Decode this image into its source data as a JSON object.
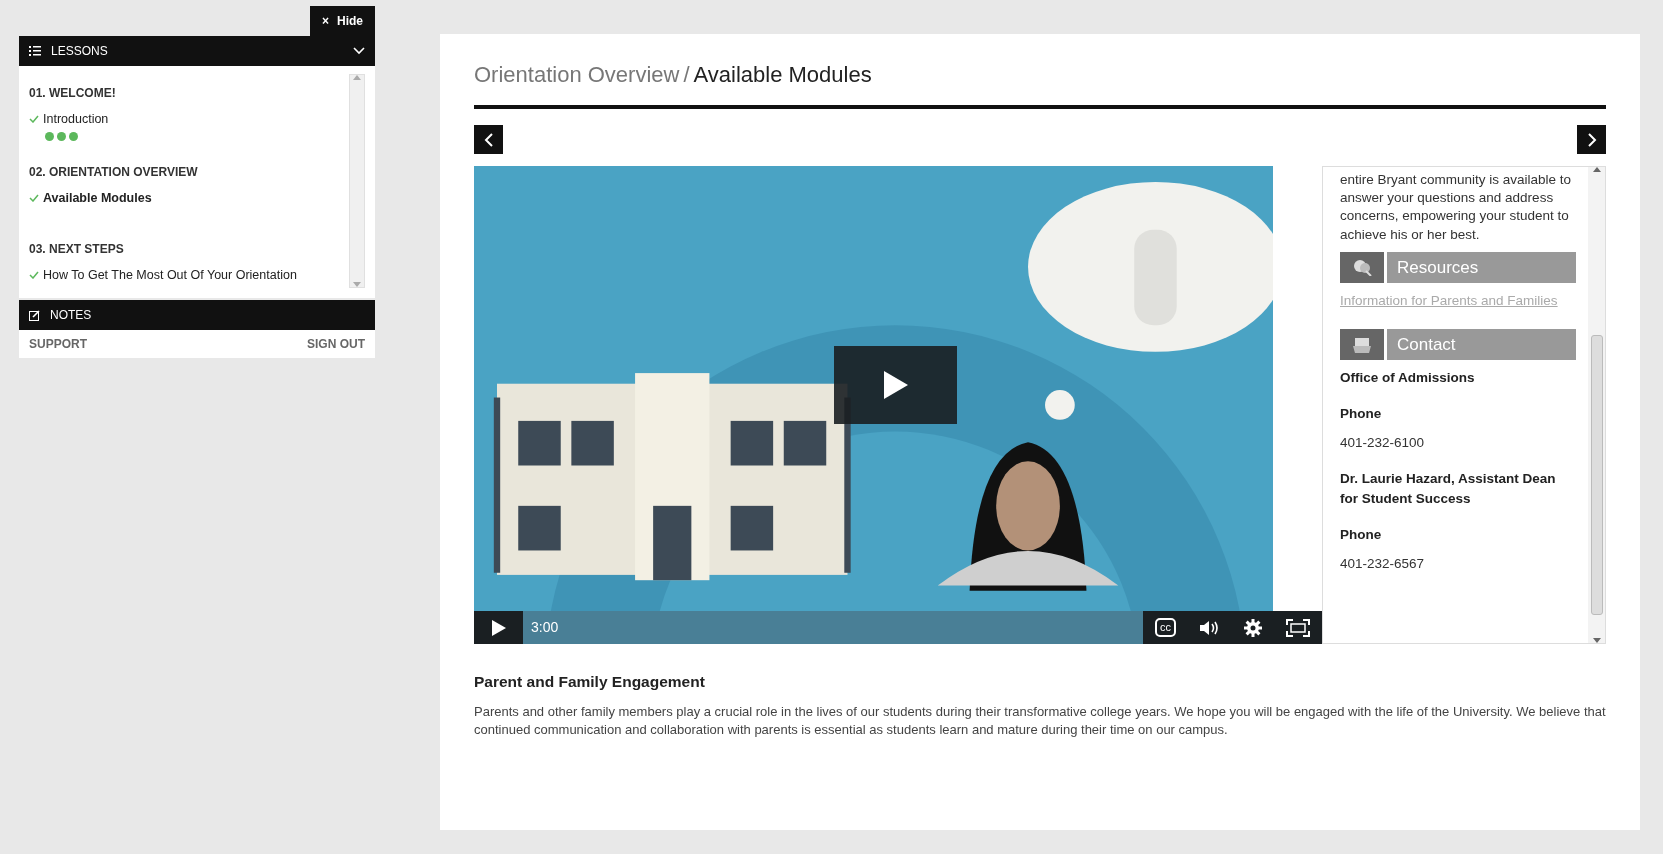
{
  "sidebar": {
    "hide_button": {
      "icon": "×",
      "label": "Hide"
    },
    "lessons_header": {
      "label": "LESSONS",
      "expanded": true
    },
    "sections": [
      {
        "title": "01. WELCOME!",
        "lessons": [
          {
            "label": "Introduction",
            "completed": true,
            "selected": false,
            "progress_dots": [
              {
                "done": true
              },
              {
                "done": true
              },
              {
                "done": true
              }
            ]
          }
        ]
      },
      {
        "title": "02. ORIENTATION OVERVIEW",
        "lessons": [
          {
            "label": "Available Modules",
            "completed": true,
            "selected": true
          }
        ]
      },
      {
        "title": "03. NEXT STEPS",
        "lessons": [
          {
            "label": "How To Get The Most Out Of Your Orientation",
            "completed": true,
            "selected": false
          }
        ]
      }
    ],
    "notes_header": {
      "label": "NOTES"
    },
    "footer_links": [
      "SUPPORT",
      "SIGN OUT"
    ]
  },
  "breadcrumb": {
    "parent": "Orientation Overview",
    "separator": "/",
    "current": "Available Modules"
  },
  "video": {
    "time": "3:00",
    "captions_label": "cc"
  },
  "side_panel": {
    "intro": "entire Bryant community is available to answer your questions and address concerns, empowering your student to achieve his or her best.",
    "resources_title": "Resources",
    "resources_link": "Information for Parents and Families",
    "contact_title": "Contact",
    "contacts": [
      {
        "name": "Office of Admissions",
        "phone_label": "Phone",
        "phone": "401-232-6100"
      },
      {
        "name": "Dr. Laurie Hazard, Assistant Dean for Student Success",
        "phone_label": "Phone",
        "phone": "401-232-6567"
      }
    ]
  },
  "article": {
    "heading": "Parent and Family Engagement",
    "body": "Parents and other family members play a crucial role in the lives of our students during their transformative college years. We hope you will be engaged with the life of the University.  We believe that continued communication and collaboration with parents is essential as students learn and mature during their time on our campus."
  }
}
